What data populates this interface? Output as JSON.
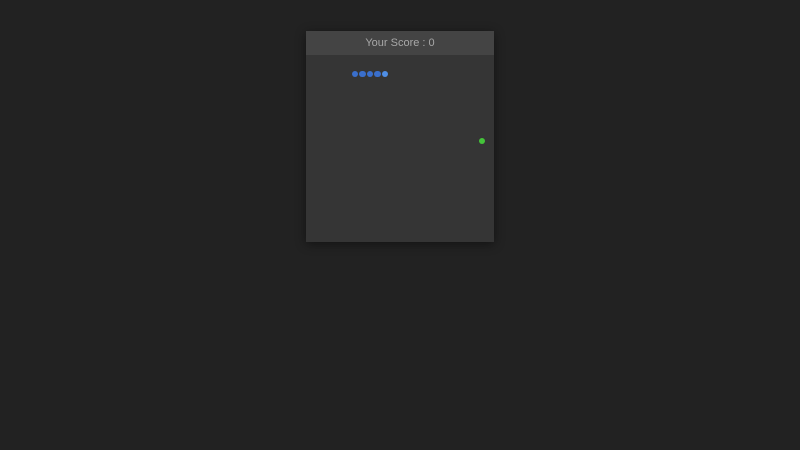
{
  "score_bar": {
    "label": "Your Score : 0"
  },
  "game": {
    "snake_length": 5,
    "colors": {
      "snake_body": "#3a6fcc",
      "snake_head": "#4f8fe6",
      "food": "#44c43a"
    }
  }
}
